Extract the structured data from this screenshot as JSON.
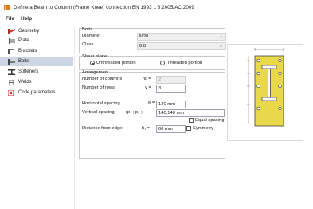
{
  "window": {
    "title": "Define a Beam to Column (Frame Knee) connection  EN 1993 1 8:2005/AC:2009"
  },
  "menu": {
    "file": "File",
    "help": "Help"
  },
  "sidebar": {
    "items": [
      {
        "label": "Geometry",
        "icon": "geometry-icon"
      },
      {
        "label": "Plate",
        "icon": "plate-icon"
      },
      {
        "label": "Brackets",
        "icon": "brackets-icon"
      },
      {
        "label": "Bolts",
        "icon": "bolts-icon",
        "selected": true
      },
      {
        "label": "Stiffeners",
        "icon": "stiffeners-icon"
      },
      {
        "label": "Welds",
        "icon": "welds-icon"
      },
      {
        "label": "Code parameters",
        "icon": "code-parameters-icon"
      }
    ]
  },
  "bolts": {
    "heading": "Bolts",
    "diameter_label": "Diameter",
    "diameter_value": "M20",
    "class_label": "Class",
    "class_value": "8.8"
  },
  "shear_plane": {
    "heading": "Shear plane",
    "unthreaded_label": "Unthreaded portion",
    "threaded_label": "Threaded portion",
    "selected": "unthreaded"
  },
  "arrangement": {
    "heading": "Arrangement",
    "columns_label": "Number of columns",
    "columns_symbol": "n",
    "columns_sub": "b",
    "columns_value": "2",
    "rows_label": "Number of rows",
    "rows_symbol": "v =",
    "rows_value": "3",
    "hspacing_label": "Horizontal spacing",
    "hspacing_symbol": "e =",
    "hspacing_value": "120 mm",
    "vspacing_label": "Vertical spacing:",
    "vspacing_symbol": "(p₁ ; p₂ ;)",
    "vspacing_value": "140,140 mm",
    "equal_spacing_label": "Equal spacing",
    "edge_label": "Distance from edge:",
    "edge_symbol": "h₁ =",
    "edge_value": "60 mm",
    "symmetry_label": "Symmetry"
  },
  "colors": {
    "selected_bg": "#cfd6e3",
    "plate_fill": "#e8d84a",
    "bolt_fill": "#ffffff",
    "icon_red": "#c0282c",
    "icon_orange": "#e07a1f"
  }
}
